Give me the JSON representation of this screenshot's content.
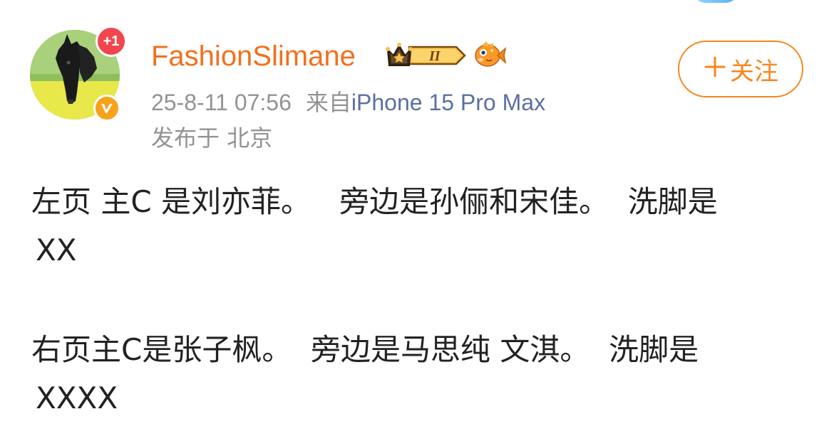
{
  "user": {
    "name": "FashionSlimane",
    "notification_badge": "+1",
    "verified_badge": "V",
    "vip_level": "II"
  },
  "meta": {
    "timestamp": "25-8-11 07:56",
    "source_prefix": "来自",
    "source_device": "iPhone 15 Pro Max",
    "location": "发布于 北京"
  },
  "follow_button": {
    "label": "关注"
  },
  "post": {
    "paragraph1": [
      "左页 主C 是刘亦菲。   旁边是孙俪和宋佳。  洗脚是",
      "XX"
    ],
    "paragraph2": [
      "右页主C是张子枫。  旁边是马思纯 文淇。  洗脚是",
      "XXXX"
    ]
  },
  "colors": {
    "username": "#f36f1d",
    "follow_accent": "#f7861d",
    "meta_gray": "#939393",
    "source_blue": "#5b6fa1",
    "notif_red": "#f2464f",
    "verified_orange": "#f7a21b"
  },
  "icons": {
    "vip": "crown-vip-badge-icon",
    "fish": "fish-badge-icon",
    "plus": "plus-icon"
  }
}
